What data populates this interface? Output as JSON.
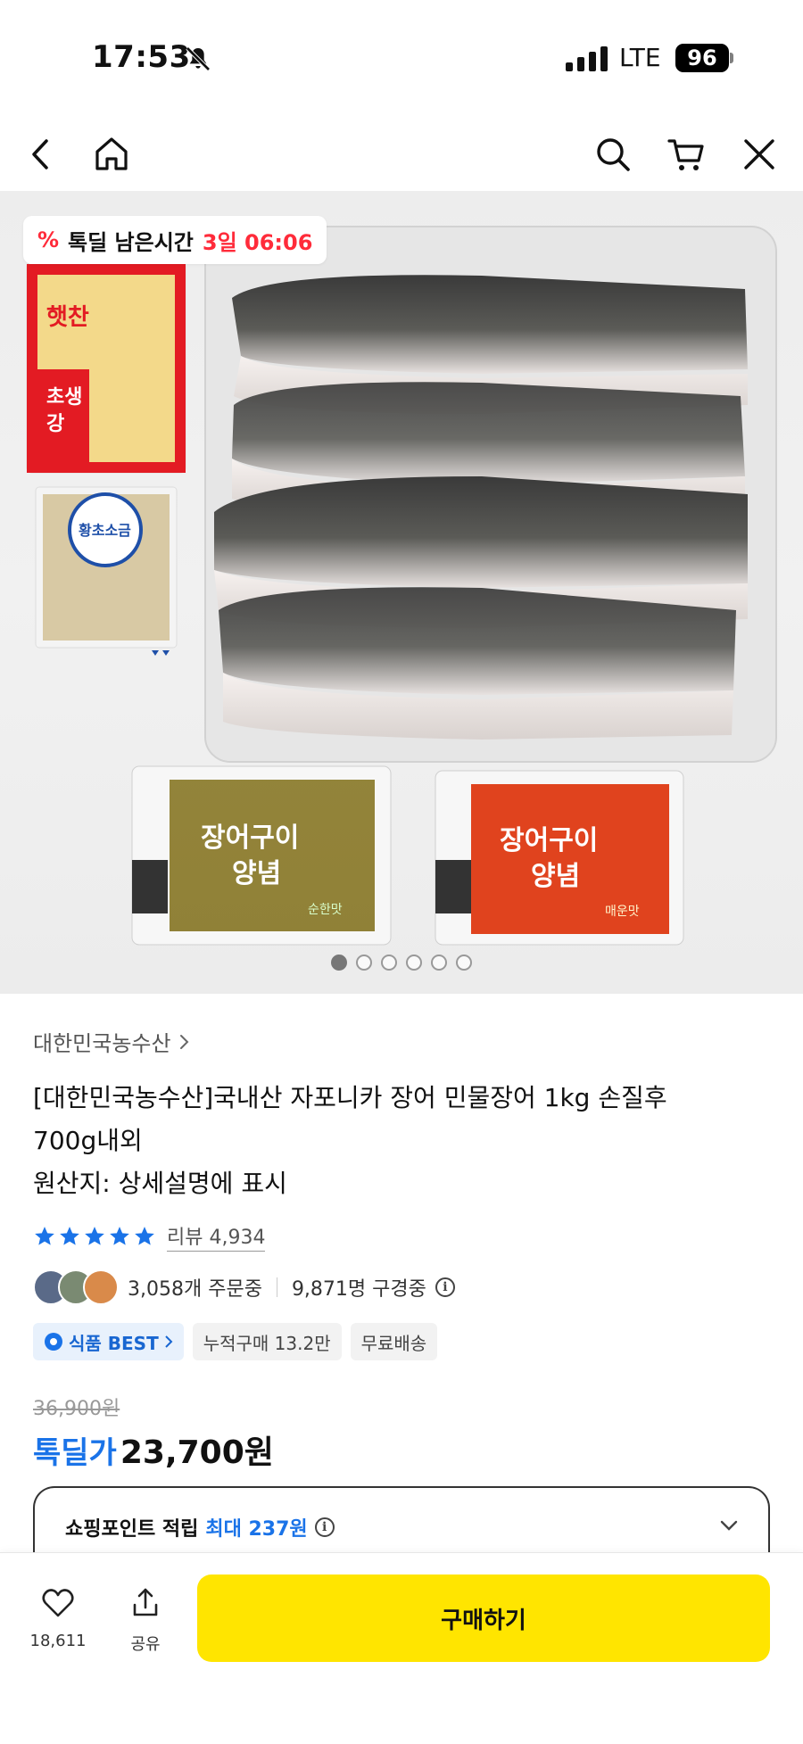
{
  "status_bar": {
    "time": "17:53",
    "network": "LTE",
    "battery": "96"
  },
  "deal_badge": {
    "icon_text": "%",
    "label": "톡딜 남은시간",
    "countdown": "3일 06:06"
  },
  "product_image": {
    "ginger_pack_text": "햇찬 초생강",
    "salt_pack_text": "황초소금",
    "sauce_left_text": "장어구이양념",
    "sauce_left_sub": "순한맛",
    "sauce_right_text": "장어구이양념",
    "sauce_right_sub": "매운맛",
    "page_count": 6,
    "active_page": 0
  },
  "seller": {
    "name": "대한민국농수산"
  },
  "product": {
    "title_line1": "[대한민국농수산]국내산 자포니카 장어 민물장어 1kg 손질후",
    "title_line2": "700g내외",
    "origin": "원산지: 상세설명에 표시"
  },
  "rating": {
    "stars": 5,
    "review_label": "리뷰 4,934"
  },
  "social": {
    "orders": "3,058개 주문중",
    "watchers": "9,871명 구경중"
  },
  "tags": {
    "best": "식품 BEST",
    "cumulative": "누적구매 13.2만",
    "shipping": "무료배송"
  },
  "price": {
    "original": "36,900원",
    "label": "톡딜가",
    "value": "23,700원"
  },
  "points": {
    "label": "쇼핑포인트 적립",
    "max": "최대 237원"
  },
  "bottom_bar": {
    "likes": "18,611",
    "share": "공유",
    "buy": "구매하기"
  },
  "colors": {
    "accent_blue": "#1a73e8",
    "deal_red": "#ff2b3a",
    "buy_yellow": "#ffe500"
  }
}
